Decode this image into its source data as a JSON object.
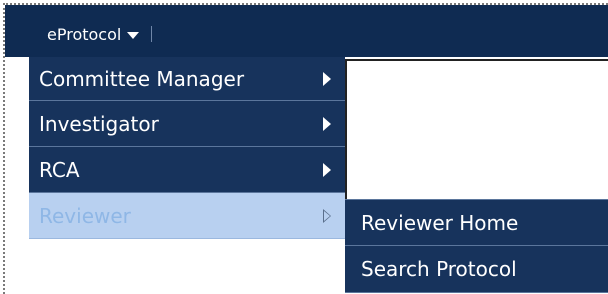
{
  "app_menu": {
    "label": "eProtocol"
  },
  "menu": {
    "items": [
      {
        "label": "Committee Manager"
      },
      {
        "label": "Investigator"
      },
      {
        "label": "RCA"
      },
      {
        "label": "Reviewer"
      }
    ]
  },
  "submenu": {
    "items": [
      {
        "label": "Reviewer Home"
      },
      {
        "label": "Search Protocol"
      }
    ]
  },
  "colors": {
    "nav_background": "#17335c",
    "active_item_background": "#b8d0f0",
    "active_item_text": "#8fb7e6"
  }
}
